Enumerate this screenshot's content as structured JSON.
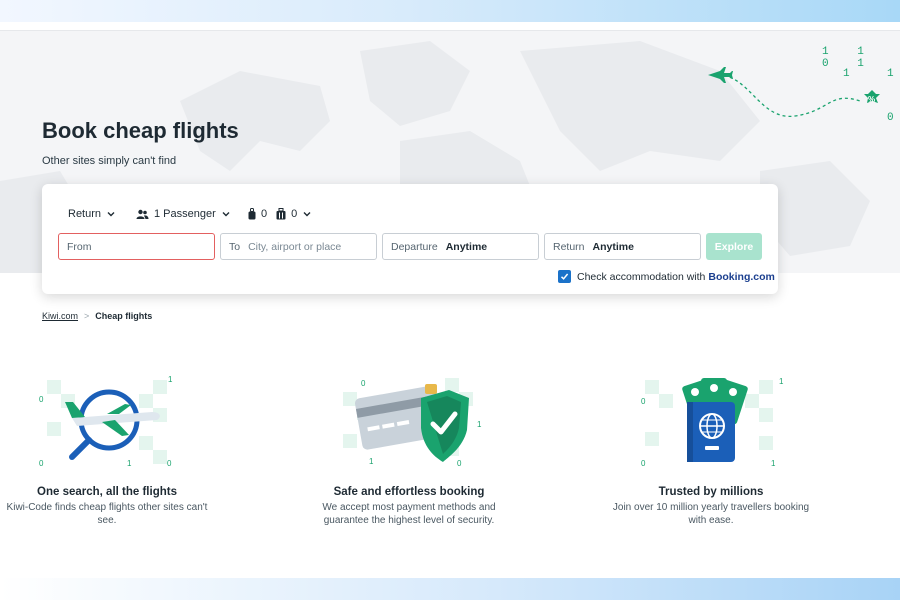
{
  "hero": {
    "title": "Book cheap flights",
    "subtitle": "Other sites simply can't find",
    "binary_row1": "1 1 0 1",
    "binary_row2": "1",
    "binary_row2b": "1",
    "binary_row3": "0"
  },
  "search": {
    "trip_type": "Return",
    "passengers": "1 Passenger",
    "cabin_bags": "0",
    "checked_bags": "0",
    "from_placeholder": "From",
    "to_label": "To",
    "to_placeholder": "City, airport or place",
    "departure_label": "Departure",
    "departure_value": "Anytime",
    "return_label": "Return",
    "return_value": "Anytime",
    "explore_label": "Explore",
    "accommodation_label": "Check accommodation with",
    "accommodation_brand": "Booking.com",
    "accommodation_checked": true
  },
  "breadcrumb": {
    "home": "Kiwi.com",
    "separator": ">",
    "current": "Cheap flights"
  },
  "features": [
    {
      "icon": "plane-magnifier-illustration",
      "title": "One search, all the flights",
      "text": "Kiwi-Code finds cheap flights other sites can't see."
    },
    {
      "icon": "card-shield-illustration",
      "title": "Safe and effortless booking",
      "text": "We accept most payment methods and guarantee the highest level of security."
    },
    {
      "icon": "passport-tickets-illustration",
      "title": "Trusted by millions",
      "text": "Join over 10 million yearly travellers booking with ease."
    }
  ],
  "decor_digits": {
    "zero": "0",
    "one": "1"
  },
  "colors": {
    "accent": "#00a991",
    "explore_disabled": "#a9e3ce",
    "from_error_border": "#e36060",
    "checkbox": "#1b72c9",
    "booking_brand": "#1b3f8f"
  }
}
